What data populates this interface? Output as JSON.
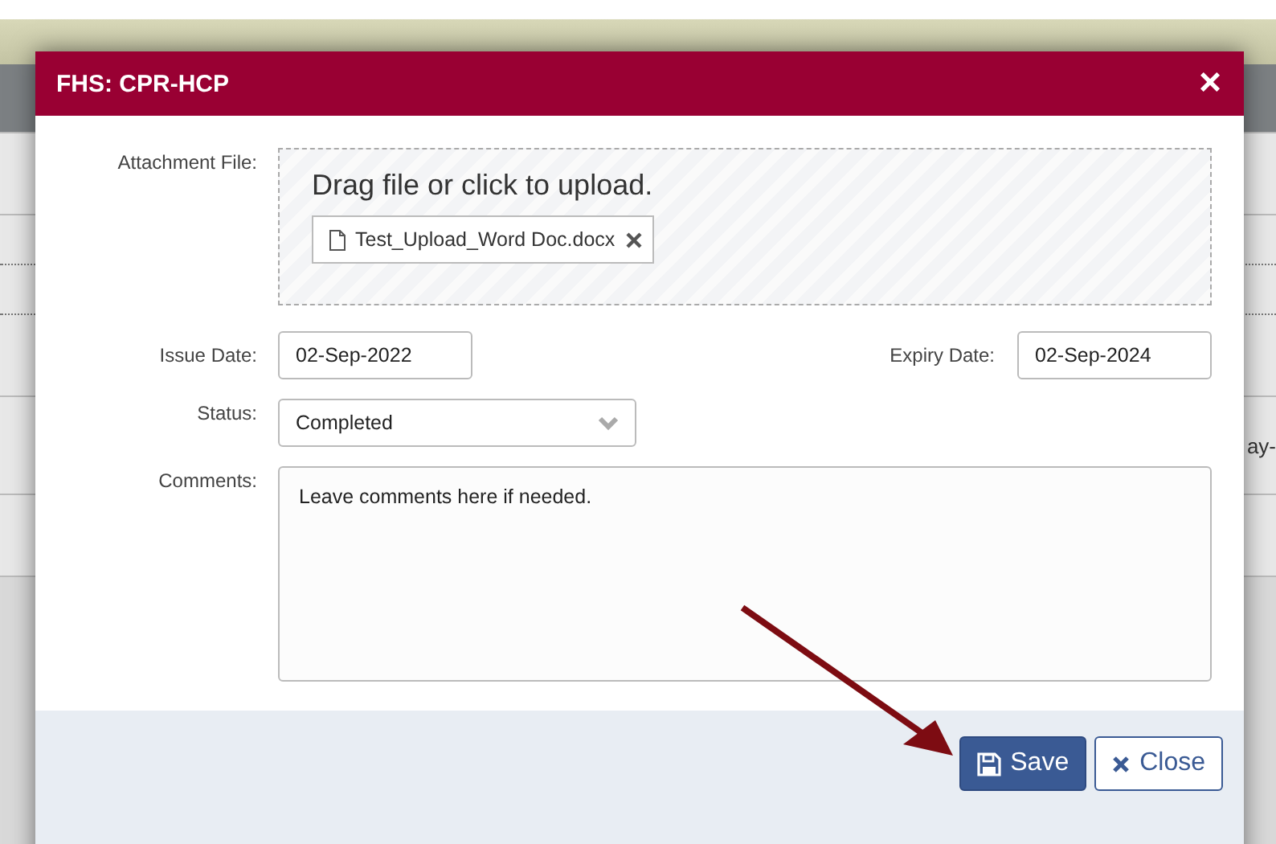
{
  "background_page": {
    "cell_text": "ay-"
  },
  "dialog": {
    "title": "FHS: CPR-HCP",
    "close_glyph": "×",
    "attachment": {
      "label": "Attachment File:",
      "prompt": "Drag file or click to upload.",
      "files": [
        {
          "name": "Test_Upload_Word Doc.docx"
        }
      ]
    },
    "issue_date": {
      "label": "Issue Date:",
      "value": "02-Sep-2022"
    },
    "expiry_date": {
      "label": "Expiry Date:",
      "value": "02-Sep-2024"
    },
    "status": {
      "label": "Status:",
      "value": "Completed"
    },
    "comments": {
      "label": "Comments:",
      "value": "Leave comments here if needed."
    },
    "buttons": [
      {
        "kind": "primary",
        "label": "Save"
      },
      {
        "kind": "secondary",
        "label": "Close"
      }
    ]
  }
}
